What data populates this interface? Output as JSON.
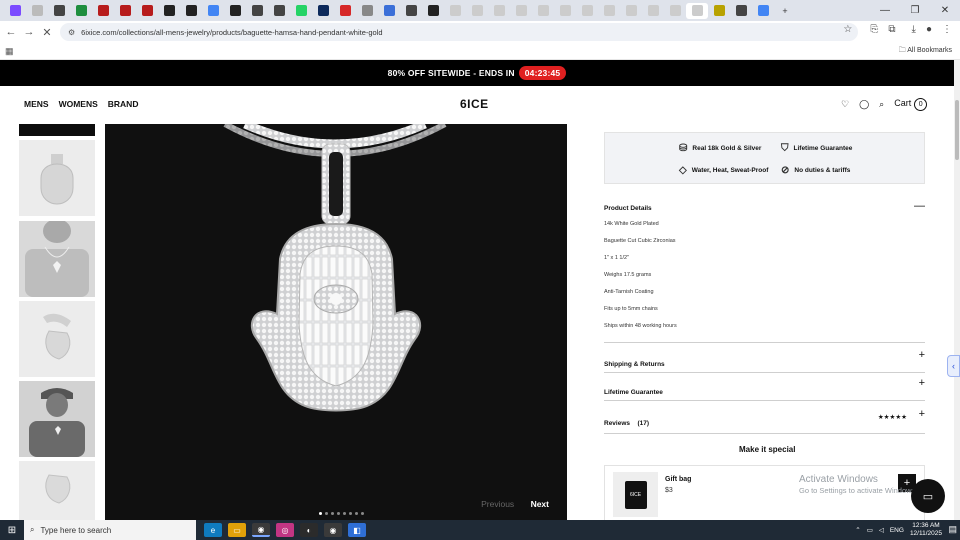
{
  "browser": {
    "tabs": [
      {
        "icon": "tab-favicon",
        "color": "#7b4bff"
      },
      {
        "icon": "tab-favicon",
        "color": "#bbbbbb"
      },
      {
        "icon": "tab-favicon",
        "color": "#444444"
      },
      {
        "icon": "tab-favicon",
        "color": "#1e8e3e"
      },
      {
        "icon": "tab-favicon",
        "color": "#b71c1c"
      },
      {
        "icon": "tab-favicon",
        "color": "#b71c1c"
      },
      {
        "icon": "tab-favicon",
        "color": "#b71c1c"
      },
      {
        "icon": "amazon-icon",
        "color": "#222222"
      },
      {
        "icon": "amazon-icon",
        "color": "#222222"
      },
      {
        "icon": "google-icon",
        "color": "#4285f4"
      },
      {
        "icon": "github-icon",
        "color": "#222222"
      },
      {
        "icon": "tab-favicon",
        "color": "#444444"
      },
      {
        "icon": "tab-favicon",
        "color": "#444444"
      },
      {
        "icon": "whatsapp-icon",
        "color": "#25d366"
      },
      {
        "icon": "tab-favicon",
        "color": "#0d2a5c"
      },
      {
        "icon": "tab-favicon",
        "color": "#d62828"
      },
      {
        "icon": "tab-favicon",
        "color": "#888888"
      },
      {
        "icon": "tab-favicon",
        "color": "#3b6fd8"
      },
      {
        "icon": "tab-favicon",
        "color": "#444444"
      },
      {
        "icon": "amazon-icon",
        "color": "#222222"
      },
      {
        "icon": "tab-favicon",
        "color": "#cccccc"
      },
      {
        "icon": "tab-favicon",
        "color": "#cccccc"
      },
      {
        "icon": "tab-favicon",
        "color": "#cccccc"
      },
      {
        "icon": "tab-favicon",
        "color": "#cccccc"
      },
      {
        "icon": "tab-favicon",
        "color": "#cccccc"
      },
      {
        "icon": "tab-favicon",
        "color": "#cccccc"
      },
      {
        "icon": "tab-favicon",
        "color": "#cccccc"
      },
      {
        "icon": "tab-favicon",
        "color": "#cccccc"
      },
      {
        "icon": "tab-favicon",
        "color": "#cccccc"
      },
      {
        "icon": "tab-favicon",
        "color": "#cccccc"
      },
      {
        "icon": "tab-favicon",
        "color": "#cccccc"
      },
      {
        "icon": "tab-favicon",
        "color": "#cccccc",
        "active": true
      },
      {
        "icon": "tab-favicon",
        "color": "#b8a200"
      },
      {
        "icon": "tab-favicon",
        "color": "#444444"
      },
      {
        "icon": "google-icon",
        "color": "#4285f4"
      }
    ],
    "url": "6ixice.com/collections/all-mens-jewelry/products/baguette-hamsa-hand-pendant-white-gold",
    "all_bookmarks": "All Bookmarks"
  },
  "promo": {
    "text": "80% OFF SITEWIDE - ENDS IN",
    "timer": "04:23:45",
    "bg": "#000000",
    "timer_color": "#e02020"
  },
  "header": {
    "menu": [
      "MENS",
      "WOMENS",
      "BRAND"
    ],
    "logo": "6ICE",
    "cart_label": "Cart",
    "cart_count": "0"
  },
  "gallery": {
    "dots": 8,
    "active_dot": 0,
    "prev_label": "Previous",
    "next_label": "Next"
  },
  "badges": [
    {
      "icon": "gold-bars-icon",
      "label": "Real 18k Gold & Silver"
    },
    {
      "icon": "shield-check-icon",
      "label": "Lifetime Guarantee"
    },
    {
      "icon": "diamond-icon",
      "label": "Water, Heat, Sweat-Proof"
    },
    {
      "icon": "no-duties-icon",
      "label": "No duties & tariffs"
    }
  ],
  "product_details": {
    "title": "Product Details",
    "items": [
      "14k White Gold Plated",
      "Baguette Cut Cubic Zirconias",
      "1\" x 1 1/2\"",
      "Weighs 17.5 grams",
      "Anti-Tarnish Coating",
      "Fits up to 5mm chains",
      "Ships within 48 working hours"
    ]
  },
  "accordions": {
    "shipping": "Shipping & Returns",
    "lifetime": "Lifetime Guarantee",
    "reviews": "Reviews",
    "reviews_count": "(17)",
    "stars": "★★★★★"
  },
  "upsell": {
    "title": "Make it special",
    "gift_title": "Gift bag",
    "gift_price": "$3",
    "bag_logo": "6ICE"
  },
  "overlay": {
    "activate_title": "Activate Windows",
    "activate_sub": "Go to Settings to activate Windows."
  },
  "taskbar": {
    "search_placeholder": "Type here to search",
    "lang": "ENG",
    "time": "12:36 AM",
    "date": "12/11/2025"
  }
}
